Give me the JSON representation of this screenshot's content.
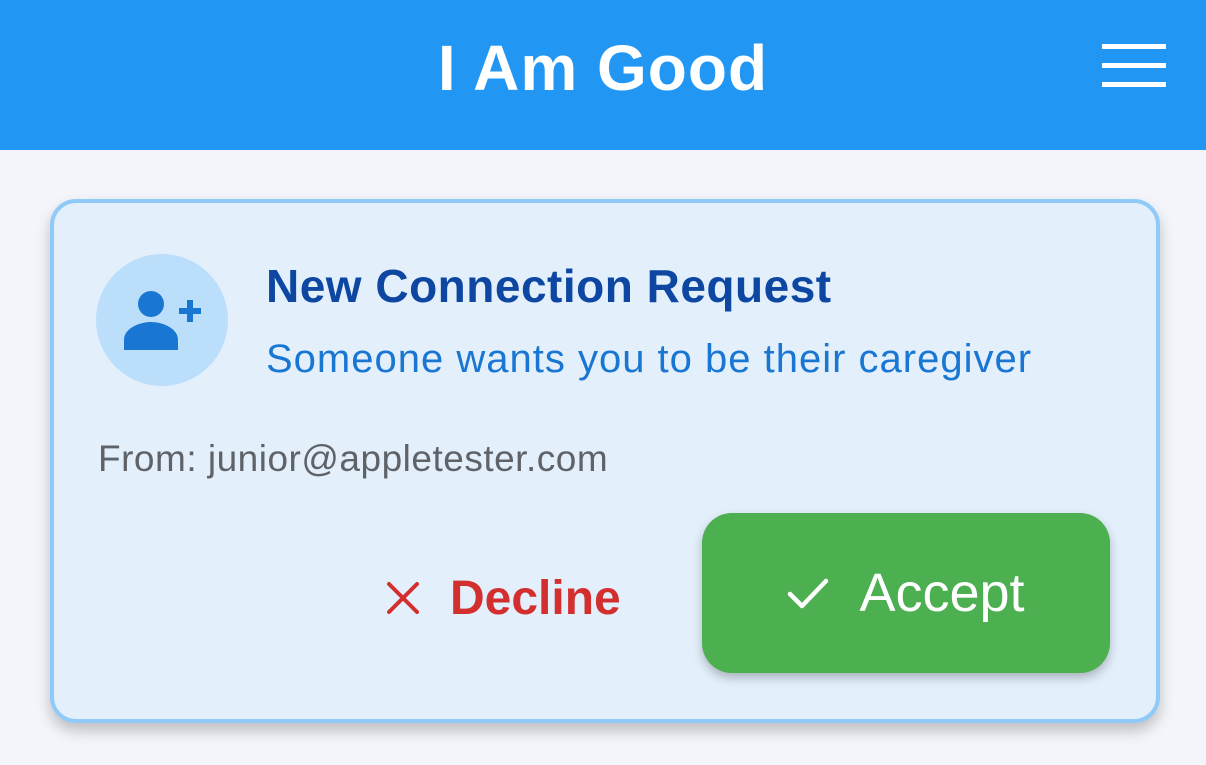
{
  "app_bar": {
    "title": "I Am Good",
    "menu_icon": "hamburger-menu-icon",
    "background_color": "#2196f3"
  },
  "request_card": {
    "avatar_icon": "person-add-icon",
    "title": "New Connection Request",
    "subtitle": "Someone wants you to be their caregiver",
    "from_text": "From: junior@appletester.com",
    "decline": {
      "label": "Decline",
      "icon": "close-icon",
      "color": "#d32f2f"
    },
    "accept": {
      "label": "Accept",
      "icon": "check-icon",
      "color": "#4caf50"
    }
  }
}
